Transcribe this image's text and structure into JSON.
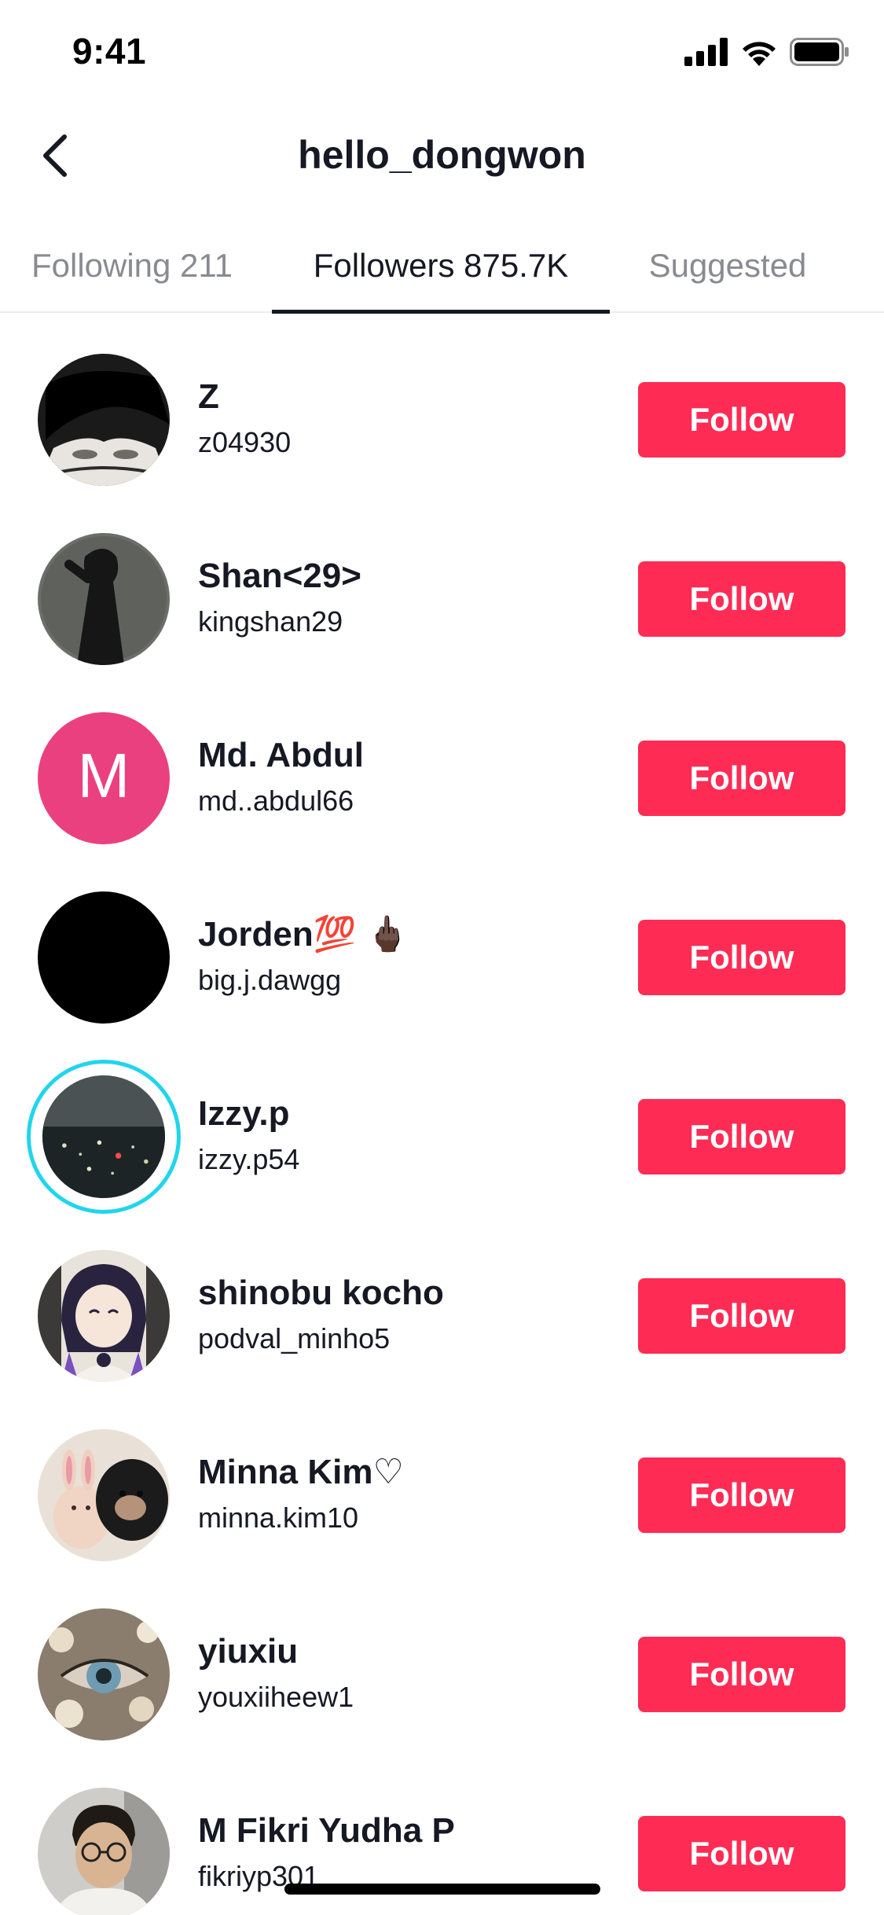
{
  "status_bar": {
    "time": "9:41"
  },
  "header": {
    "title": "hello_dongwon"
  },
  "tabs": [
    {
      "label": "Following 211",
      "active": false
    },
    {
      "label": "Followers 875.7K",
      "active": true
    },
    {
      "label": "Suggested",
      "active": false
    }
  ],
  "users": [
    {
      "display_name": "Z",
      "username": "z04930",
      "button": "Follow",
      "avatar": "dark-anime-face"
    },
    {
      "display_name": "Shan<29>",
      "username": "kingshan29",
      "button": "Follow",
      "avatar": "shadow-silhouette"
    },
    {
      "display_name": "Md. Abdul",
      "username": "md..abdul66",
      "button": "Follow",
      "avatar": "letter-m",
      "avatar_letter": "M"
    },
    {
      "display_name": "Jorden💯 🖕🏿",
      "username": "big.j.dawgg",
      "button": "Follow",
      "avatar": "black-circle"
    },
    {
      "display_name": "Izzy.p",
      "username": "izzy.p54",
      "button": "Follow",
      "avatar": "night-city",
      "has_story_ring": true
    },
    {
      "display_name": "shinobu kocho",
      "username": "podval_minho5",
      "button": "Follow",
      "avatar": "anime-character"
    },
    {
      "display_name": "Minna Kim♡",
      "username": "minna.kim10",
      "button": "Follow",
      "avatar": "bunny-and-dog"
    },
    {
      "display_name": "yiuxiu",
      "username": "youxiiheew1",
      "button": "Follow",
      "avatar": "eye-with-flowers"
    },
    {
      "display_name": "M Fikri Yudha P",
      "username": "fikriyp301",
      "button": "Follow",
      "avatar": "person-with-glasses"
    }
  ],
  "colors": {
    "follow_button": "#fe2c55",
    "story_ring": "#20d5ec",
    "avatar_m_bg": "#ea4080"
  }
}
